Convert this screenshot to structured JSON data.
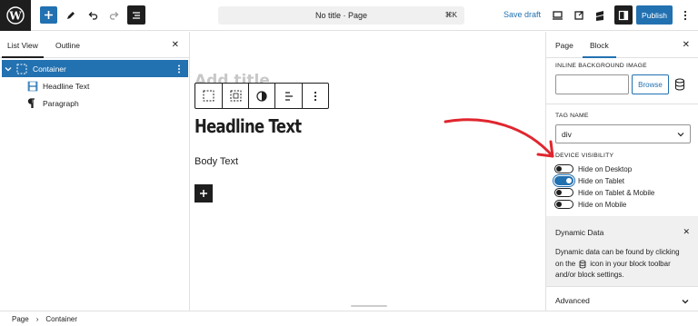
{
  "header": {
    "document_title": "No title · Page",
    "shortcut": "⌘K",
    "save_draft": "Save draft",
    "publish": "Publish"
  },
  "left_panel": {
    "tabs": [
      "List View",
      "Outline"
    ],
    "tree": [
      {
        "label": "Container",
        "icon": "container-icon",
        "selected": true
      },
      {
        "label": "Headline Text",
        "icon": "heading-icon",
        "selected": false
      },
      {
        "label": "Paragraph",
        "icon": "paragraph-icon",
        "selected": false
      }
    ]
  },
  "canvas": {
    "title_placeholder": "Add title",
    "headline": "Headline Text",
    "body": "Body Text"
  },
  "right_panel": {
    "tabs": [
      "Page",
      "Block"
    ],
    "inline_bg_label": "INLINE BACKGROUND IMAGE",
    "browse": "Browse",
    "tag_name_label": "TAG NAME",
    "tag_name_value": "div",
    "visibility_label": "DEVICE VISIBILITY",
    "toggles": [
      {
        "label": "Hide on Desktop",
        "on": false
      },
      {
        "label": "Hide on Tablet",
        "on": true
      },
      {
        "label": "Hide on Tablet & Mobile",
        "on": false
      },
      {
        "label": "Hide on Mobile",
        "on": false
      }
    ],
    "dynamic_title": "Dynamic Data",
    "dynamic_text_1": "Dynamic data can be found by clicking",
    "dynamic_text_2a": "on the",
    "dynamic_text_2b": "icon in your block toolbar",
    "dynamic_text_3": "and/or block settings.",
    "advanced": "Advanced"
  },
  "footer": {
    "crumbs": [
      "Page",
      "Container"
    ]
  },
  "colors": {
    "accent": "#2271b1",
    "dark": "#1e1e1e",
    "annotation_arrow": "#e0262e"
  }
}
